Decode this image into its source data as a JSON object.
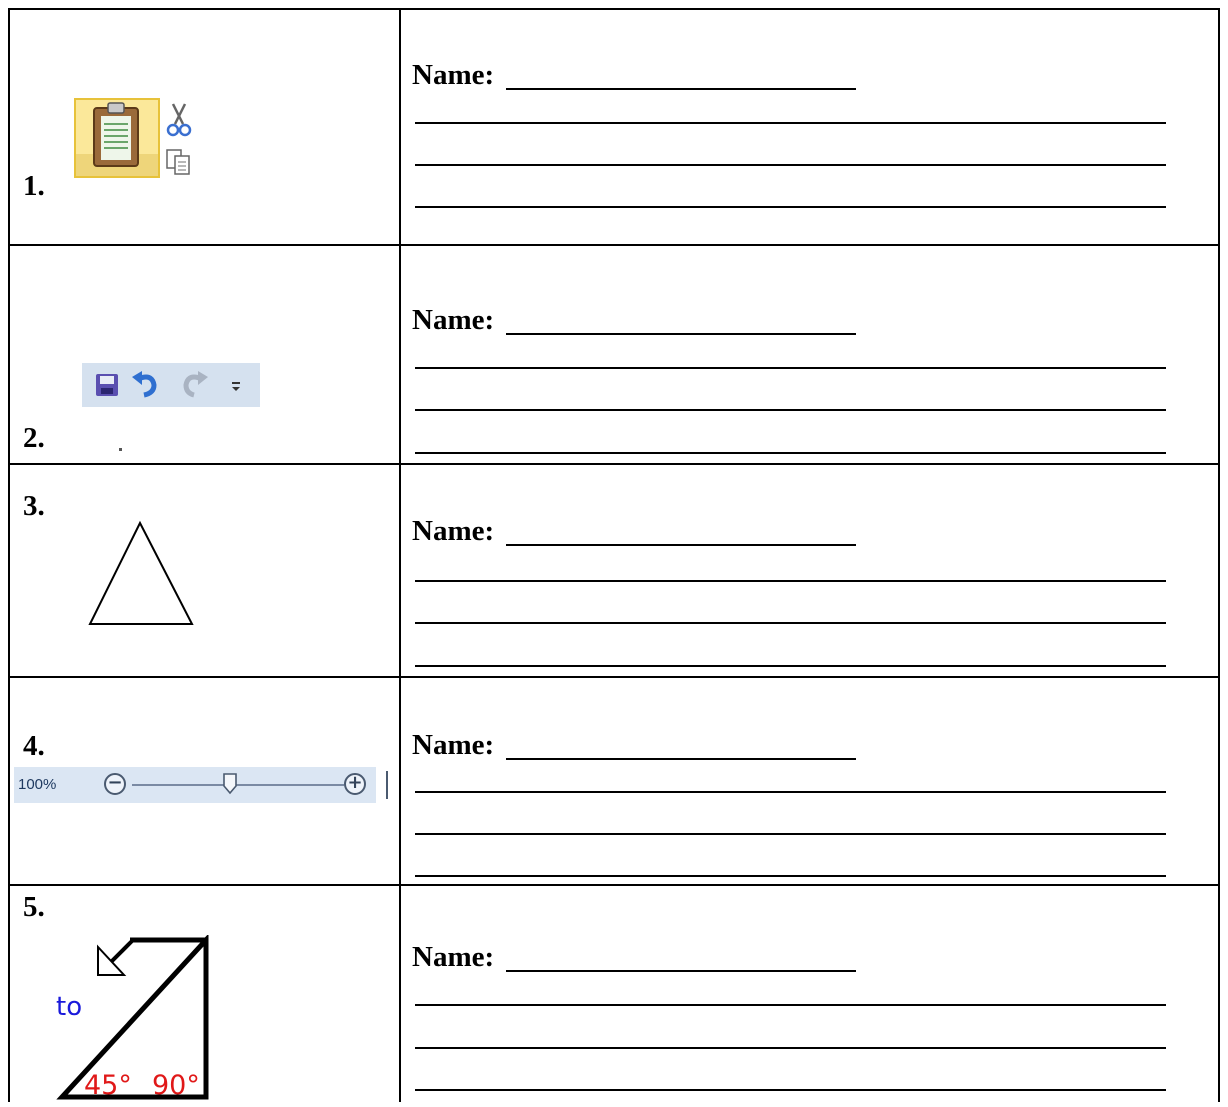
{
  "rows": [
    {
      "number": "1.",
      "name_label": "Name:"
    },
    {
      "number": "2.",
      "name_label": "Name:"
    },
    {
      "number": "3.",
      "name_label": "Name:"
    },
    {
      "number": "4.",
      "name_label": "Name:"
    },
    {
      "number": "5.",
      "name_label": "Name:"
    }
  ],
  "icons": {
    "row1": [
      "paste-clipboard-icon",
      "cut-scissors-icon",
      "copy-icon"
    ],
    "row2": [
      "save-icon",
      "undo-icon",
      "redo-icon",
      "customize-toolbar-dropdown-icon"
    ],
    "row3": [
      "triangle-shape-icon"
    ],
    "row5": [
      "rotate-arrow-icon",
      "right-triangle-icon"
    ]
  },
  "zoom_slider": {
    "label": "100%",
    "minus": "−",
    "plus": "+",
    "level_fraction": 0.5
  },
  "rotate_figure": {
    "word": "to",
    "angle_a": "45°",
    "angle_b": "90°",
    "word_color": "#1a1adb",
    "angle_color": "#e01818"
  }
}
